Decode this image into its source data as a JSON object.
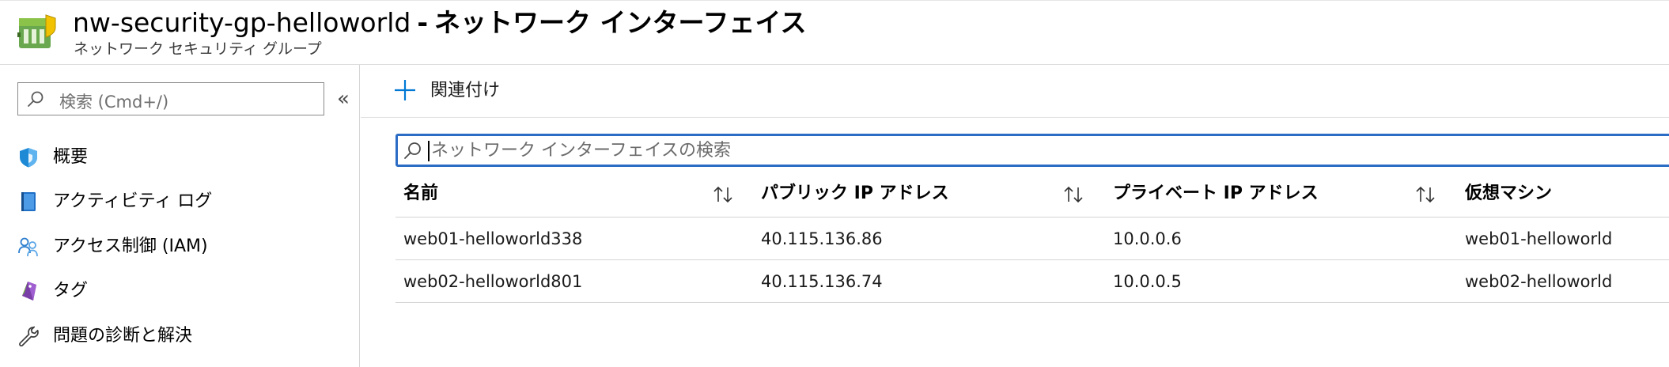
{
  "header": {
    "resource_name": "nw-security-gp-helloworld",
    "separator": "-",
    "section_title": "ネットワーク インターフェイス",
    "subtitle": "ネットワーク セキュリティ グループ"
  },
  "sidebar": {
    "search_placeholder": "検索 (Cmd+/)",
    "collapse_glyph": "«",
    "items": [
      {
        "label": "概要",
        "icon": "shield-icon"
      },
      {
        "label": "アクティビティ ログ",
        "icon": "activity-log-icon"
      },
      {
        "label": "アクセス制御 (IAM)",
        "icon": "people-icon"
      },
      {
        "label": "タグ",
        "icon": "tag-icon"
      },
      {
        "label": "問題の診断と解決",
        "icon": "wrench-icon"
      }
    ]
  },
  "toolbar": {
    "associate_label": "関連付け"
  },
  "grid": {
    "search_placeholder": "ネットワーク インターフェイスの検索",
    "columns": [
      "名前",
      "パブリック IP アドレス",
      "プライベート IP アドレス",
      "仮想マシン"
    ],
    "rows": [
      [
        "web01-helloworld338",
        "40.115.136.86",
        "10.0.0.6",
        "web01-helloworld"
      ],
      [
        "web02-helloworld801",
        "40.115.136.74",
        "10.0.0.5",
        "web02-helloworld"
      ]
    ]
  },
  "colors": {
    "accent": "#0078d4",
    "focus_border": "#2b6cc4",
    "icon_green": "#5c9c2e"
  }
}
